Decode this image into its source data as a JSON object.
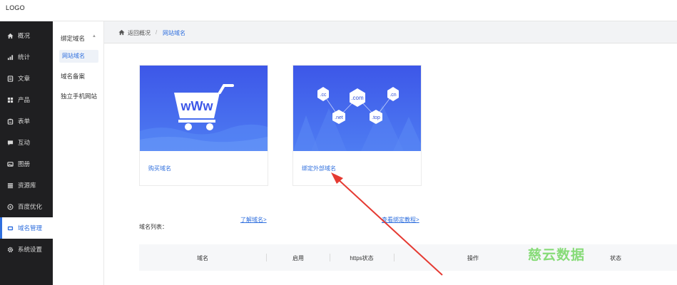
{
  "topbar": {
    "logo": "LOGO"
  },
  "sidebar": {
    "items": [
      {
        "label": "概况",
        "icon": "home-icon"
      },
      {
        "label": "统计",
        "icon": "chart-icon"
      },
      {
        "label": "文章",
        "icon": "article-icon"
      },
      {
        "label": "产品",
        "icon": "product-icon"
      },
      {
        "label": "表单",
        "icon": "form-icon"
      },
      {
        "label": "互动",
        "icon": "chat-icon"
      },
      {
        "label": "图册",
        "icon": "album-icon"
      },
      {
        "label": "资源库",
        "icon": "database-icon"
      },
      {
        "label": "百度优化",
        "icon": "seo-icon"
      },
      {
        "label": "域名管理",
        "icon": "domain-icon",
        "active": true
      },
      {
        "label": "系统设置",
        "icon": "gear-icon"
      }
    ]
  },
  "subnav": {
    "group_title": "绑定域名",
    "group_items": [
      "网站域名"
    ],
    "items": [
      "域名备案",
      "独立手机网站"
    ]
  },
  "breadcrumb": {
    "back": "返回概况",
    "separator": "/",
    "current": "网站域名"
  },
  "cards": [
    {
      "label": "购买域名",
      "illustration": "shopping-cart-www"
    },
    {
      "label": "绑定外部域名",
      "illustration": "domain-hexagons",
      "hex_labels": [
        ".cc",
        ".com",
        ".cn",
        ".net",
        ".top"
      ]
    }
  ],
  "links": {
    "learn": "了解域名>",
    "tutorial": "查看绑定教程>"
  },
  "table": {
    "title": "域名列表：",
    "headers": [
      "域名",
      "启用",
      "https状态",
      "操作",
      "状态"
    ]
  },
  "watermark": "慈云数据",
  "colors": {
    "accent": "#2f6fde",
    "sidebar_bg": "#1f1f21",
    "annotation_arrow": "#e53a32",
    "watermark": "#7bd86b"
  }
}
